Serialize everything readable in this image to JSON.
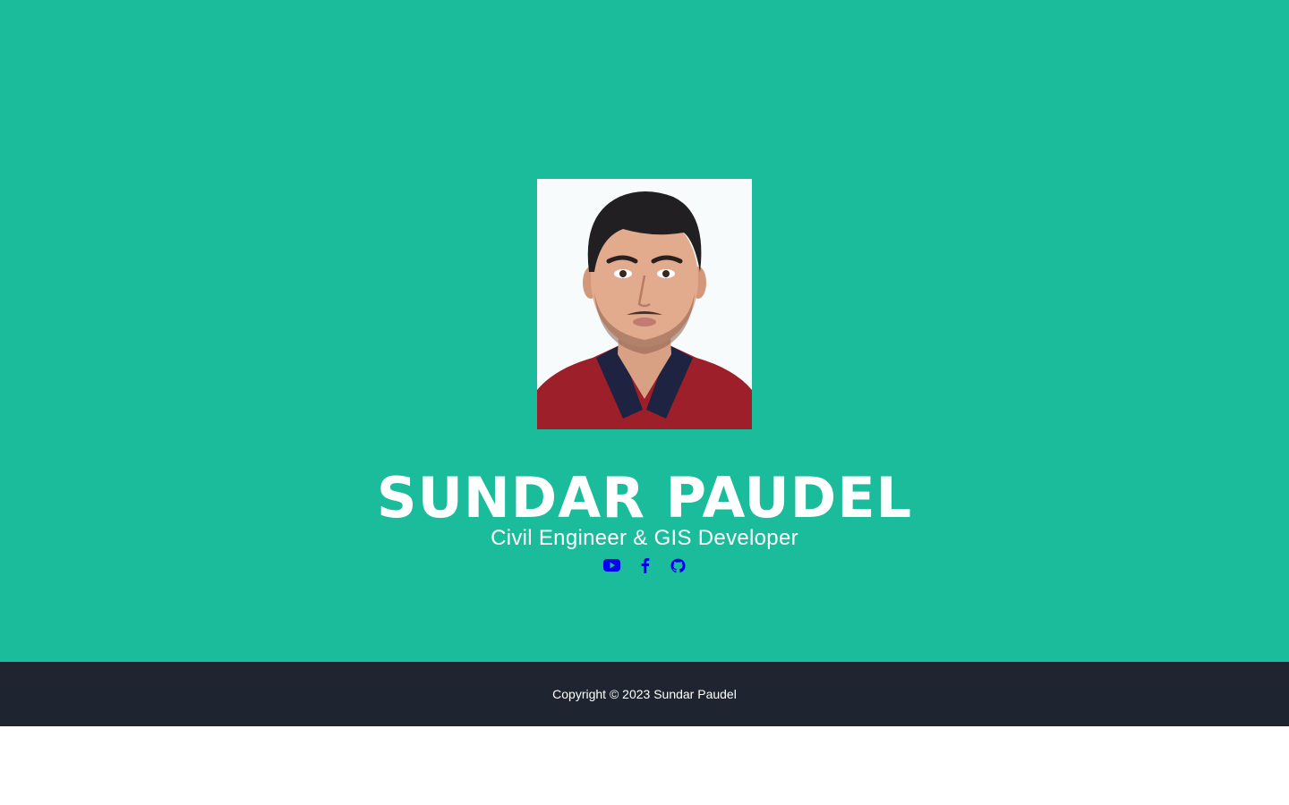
{
  "hero": {
    "name": "SUNDAR PAUDEL",
    "subtitle": "Civil Engineer & GIS Developer",
    "background_color": "#1abc9c",
    "portrait_alt": "Sundar Paudel"
  },
  "social": {
    "icon_color": "#0000ee",
    "links": [
      {
        "icon": "youtube-icon"
      },
      {
        "icon": "facebook-icon"
      },
      {
        "icon": "github-icon"
      }
    ]
  },
  "footer": {
    "copyright": "Copyright © 2023 Sundar Paudel",
    "background_color": "#1e2530"
  }
}
